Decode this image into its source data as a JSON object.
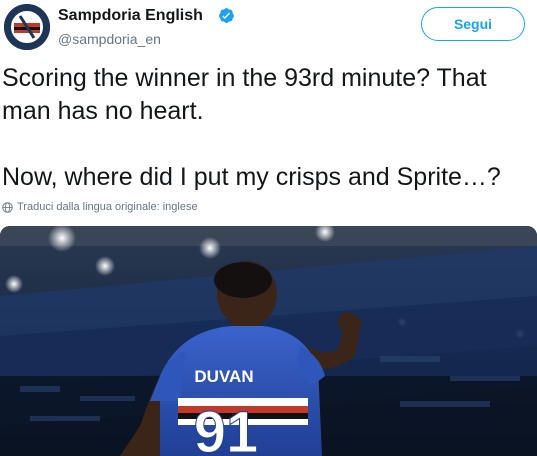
{
  "account": {
    "display_name": "Sampdoria English",
    "handle": "@sampdoria_en",
    "verified": true,
    "avatar_icon": "sampdoria-crest-icon"
  },
  "follow_button": {
    "label": "Segui"
  },
  "tweet": {
    "line1": "Scoring the winner in the 93rd minute? That",
    "line2": "man has no heart.",
    "line3": "Now, where did I put my crisps and Sprite…?"
  },
  "translate": {
    "label": "Traduci dalla lingua originale: inglese",
    "icon": "globe-icon"
  },
  "media": {
    "jersey_name": "DUVAN",
    "jersey_number": "91"
  },
  "colors": {
    "accent": "#1da1f2",
    "muted": "#657786",
    "text": "#14171a",
    "jersey_blue": "#2a4fb0"
  }
}
